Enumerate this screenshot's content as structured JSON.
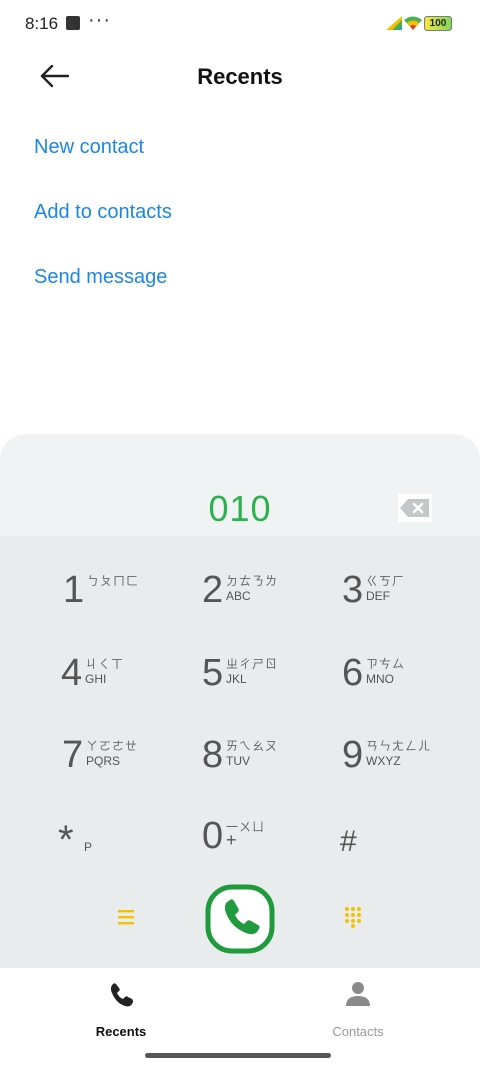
{
  "status": {
    "time": "8:16",
    "overflow": "···",
    "battery": "100"
  },
  "header": {
    "title": "Recents",
    "back_icon": "arrow-left-icon"
  },
  "actions": {
    "new_contact": "New contact",
    "add_to_contacts": "Add to contacts",
    "send_message": "Send message"
  },
  "dialer": {
    "number": "010",
    "keys": [
      {
        "digit": "1",
        "zhuyin": "ㄅㄆㄇㄈ",
        "letters": ""
      },
      {
        "digit": "2",
        "zhuyin": "ㄉㄊㄋㄌ",
        "letters": "ABC"
      },
      {
        "digit": "3",
        "zhuyin": "ㄍㄎㄏ",
        "letters": "DEF"
      },
      {
        "digit": "4",
        "zhuyin": "ㄐㄑㄒ",
        "letters": "GHI"
      },
      {
        "digit": "5",
        "zhuyin": "ㄓㄔㄕㄖ",
        "letters": "JKL"
      },
      {
        "digit": "6",
        "zhuyin": "ㄗㄘㄙ",
        "letters": "MNO"
      },
      {
        "digit": "7",
        "zhuyin": "ㄚㄛㄜㄝ",
        "letters": "PQRS"
      },
      {
        "digit": "8",
        "zhuyin": "ㄞㄟㄠㄡ",
        "letters": "TUV"
      },
      {
        "digit": "9",
        "zhuyin": "ㄢㄣㄤㄥㄦ",
        "letters": "WXYZ"
      },
      {
        "digit": "*",
        "zhuyin": "",
        "letters": "P"
      },
      {
        "digit": "0",
        "zhuyin": "一ㄨㄩ",
        "letters": "+"
      },
      {
        "digit": "#",
        "zhuyin": "",
        "letters": ""
      }
    ]
  },
  "nav": {
    "recents": "Recents",
    "contacts": "Contacts"
  },
  "colors": {
    "link": "#1a86e8",
    "number": "#2bb24c",
    "call": "#1f9a3d",
    "accent_yellow": "#f2c200"
  }
}
